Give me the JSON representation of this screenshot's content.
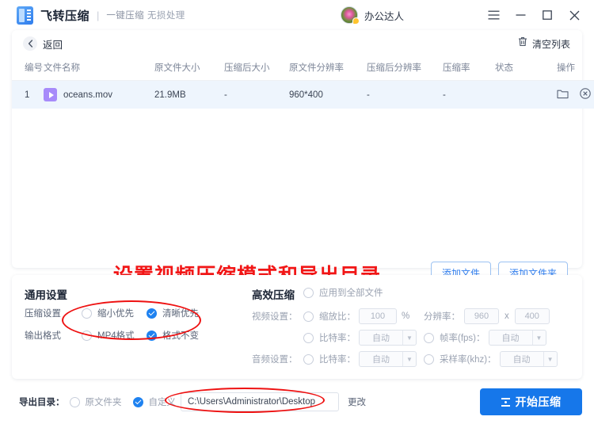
{
  "app": {
    "brand_name": "飞转压缩",
    "divider": "|",
    "tagline_1": "一键压缩",
    "tagline_2": "无损处理",
    "logo_icon": "app-logo-icon",
    "user_name": "办公达人",
    "avatar_icon": "user-avatar",
    "window_controls": {
      "menu": "menu-icon",
      "minimize": "minimize-icon",
      "maximize": "maximize-icon",
      "close": "close-icon"
    }
  },
  "list_panel": {
    "back_label": "返回",
    "back_icon": "chevron-left-icon",
    "clear_label": "清空列表",
    "clear_icon": "trash-icon",
    "columns": [
      "编号",
      "文件名称",
      "原文件大小",
      "压缩后大小",
      "原文件分辨率",
      "压缩后分辨率",
      "压缩率",
      "状态",
      "操作"
    ],
    "rows": [
      {
        "no": "1",
        "file_icon": "video-file-icon",
        "name": "oceans.mov",
        "orig_size": "21.9MB",
        "comp_size": "-",
        "orig_res": "960*400",
        "comp_res": "-",
        "ratio": "-",
        "state": "",
        "actions": [
          "folder-icon",
          "remove-circle-icon"
        ]
      }
    ]
  },
  "annotation": {
    "text": "设置视频压缩模式和导出目录",
    "color": "#f21616"
  },
  "add_buttons": [
    {
      "label": "添加文件"
    },
    {
      "label": "添加文件夹"
    }
  ],
  "general_settings": {
    "title": "通用设置",
    "rows": [
      {
        "label": "压缩设置",
        "options": [
          {
            "label": "缩小优先",
            "selected": false
          },
          {
            "label": "清晰优先",
            "selected": true
          }
        ]
      },
      {
        "label": "输出格式",
        "options": [
          {
            "label": "MP4格式",
            "selected": false
          },
          {
            "label": "格式不变",
            "selected": true
          }
        ]
      }
    ]
  },
  "high_efficiency": {
    "title": "高效压缩",
    "apply_all": {
      "label": "应用到全部文件",
      "selected": false
    },
    "video_label": "视频设置：",
    "audio_label": "音频设置：",
    "scale": {
      "label": "缩放比：",
      "value": "100",
      "unit": "%",
      "selected": false
    },
    "resolution": {
      "label": "分辨率：",
      "width": "960",
      "sep": "x",
      "height": "400"
    },
    "video_bitrate": {
      "label": "比特率：",
      "value": "自动",
      "selected": false
    },
    "framerate": {
      "label": "帧率(fps)：",
      "value": "自动",
      "selected": false
    },
    "audio_bitrate": {
      "label": "比特率：",
      "value": "自动",
      "selected": false
    },
    "samplerate": {
      "label": "采样率(khz)：",
      "value": "自动",
      "selected": false
    },
    "dropdown_icon": "chevron-down-icon"
  },
  "export": {
    "label": "导出目录：",
    "options": [
      {
        "label": "原文件夹",
        "selected": false
      },
      {
        "label": "自定义",
        "selected": true
      }
    ],
    "path": "C:\\Users\\Administrator\\Desktop",
    "change_label": "更改"
  },
  "start_button": {
    "label": "开始压缩",
    "icon": "compress-icon",
    "color": "#1677ea"
  }
}
